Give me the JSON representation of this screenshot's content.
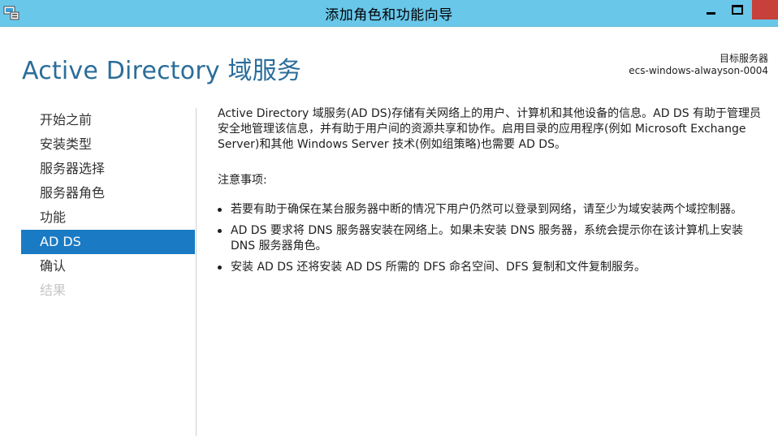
{
  "window": {
    "title": "添加角色和功能向导",
    "app_icon": "server-manager-icon",
    "controls": {
      "minimize": "minimize-icon",
      "maximize": "maximize-icon",
      "close": "close-icon"
    }
  },
  "header": {
    "page_title": "Active Directory 域服务",
    "destination_label": "目标服务器",
    "destination_server": "ecs-windows-alwayson-0004"
  },
  "nav": {
    "items": [
      {
        "label": "开始之前",
        "state": "normal"
      },
      {
        "label": "安装类型",
        "state": "normal"
      },
      {
        "label": "服务器选择",
        "state": "normal"
      },
      {
        "label": "服务器角色",
        "state": "normal"
      },
      {
        "label": "功能",
        "state": "normal"
      },
      {
        "label": "AD DS",
        "state": "active"
      },
      {
        "label": "确认",
        "state": "normal"
      },
      {
        "label": "结果",
        "state": "disabled"
      }
    ]
  },
  "content": {
    "intro": "Active Directory 域服务(AD DS)存储有关网络上的用户、计算机和其他设备的信息。AD DS 有助于管理员安全地管理该信息，并有助于用户间的资源共享和协作。启用目录的应用程序(例如 Microsoft Exchange Server)和其他 Windows Server 技术(例如组策略)也需要 AD DS。",
    "notes_heading": "注意事项:",
    "bullets": [
      "若要有助于确保在某台服务器中断的情况下用户仍然可以登录到网络，请至少为域安装两个域控制器。",
      "AD DS 要求将 DNS 服务器安装在网络上。如果未安装 DNS 服务器，系统会提示你在该计算机上安装 DNS 服务器角色。",
      "安装 AD DS 还将安装 AD DS 所需的 DFS 命名空间、DFS 复制和文件复制服务。"
    ]
  },
  "colors": {
    "titlebar": "#69c7ea",
    "accent": "#1a7bc4",
    "title_text": "#2b6d9a",
    "close_button": "#c7403a",
    "disabled_text": "#c6c6c6"
  }
}
